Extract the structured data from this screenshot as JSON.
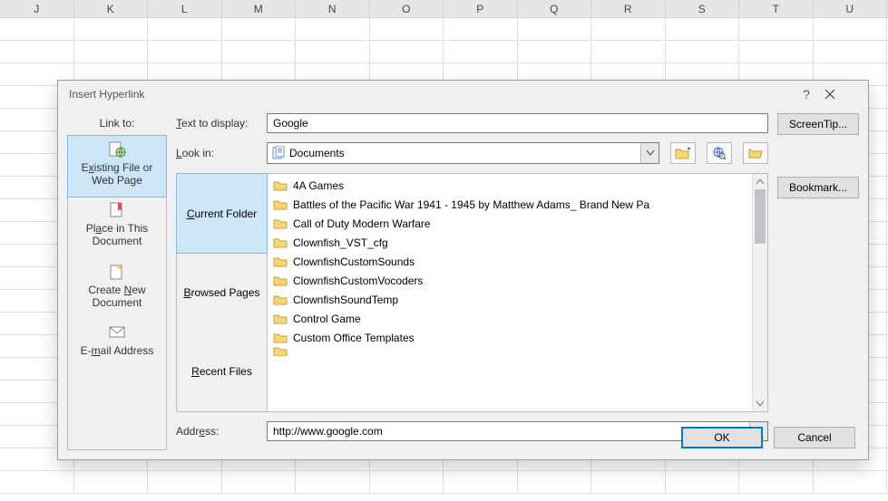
{
  "columns": [
    "J",
    "K",
    "L",
    "M",
    "N",
    "O",
    "P",
    "Q",
    "R",
    "S",
    "T",
    "U"
  ],
  "dialog": {
    "title": "Insert Hyperlink",
    "linkto_label": "Link to:",
    "linkto": [
      {
        "label_parts": [
          "E",
          "x",
          "isting File or Web Page"
        ],
        "label": "Existing File or Web Page",
        "icon": "page-globe",
        "active": true
      },
      {
        "label_parts": [
          "Pl",
          "a",
          "ce in This Document"
        ],
        "label": "Place in This Document",
        "icon": "page-bookmark",
        "active": false
      },
      {
        "label_parts": [
          "Create ",
          "N",
          "ew Document"
        ],
        "label": "Create New Document",
        "icon": "page-new",
        "active": false
      },
      {
        "label_parts": [
          "E-",
          "m",
          "ail Address"
        ],
        "label": "E-mail Address",
        "icon": "envelope",
        "active": false
      }
    ],
    "text_to_display_label": "Text to display:",
    "text_to_display": "Google",
    "look_in_label": "Look in:",
    "look_in": "Documents",
    "browse_tabs": [
      {
        "label": "Current Folder",
        "u": "C",
        "active": true
      },
      {
        "label": "Browsed Pages",
        "u": "B",
        "active": false
      },
      {
        "label": "Recent Files",
        "u": "R",
        "active": false
      }
    ],
    "files": [
      "4A Games",
      "Battles of the Pacific War 1941 - 1945 by Matthew Adams_ Brand New Pa",
      "Call of Duty Modern Warfare",
      "Clownfish_VST_cfg",
      "ClownfishCustomSounds",
      "ClownfishCustomVocoders",
      "ClownfishSoundTemp",
      "Control Game",
      "Custom Office Templates"
    ],
    "address_label": "Address:",
    "address": "http://www.google.com",
    "screentip_label": "ScreenTip...",
    "bookmark_label": "Bookmark...",
    "ok_label": "OK",
    "cancel_label": "Cancel"
  }
}
